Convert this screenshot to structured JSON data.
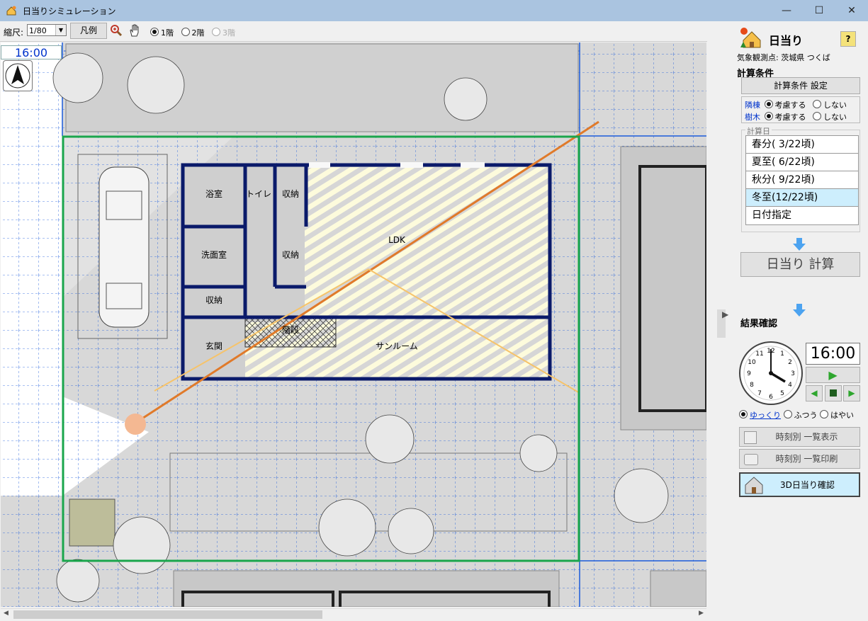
{
  "window": {
    "title": "日当りシミュレーション",
    "minimize_glyph": "—",
    "maximize_glyph": "☐",
    "close_glyph": "✕"
  },
  "toolbar": {
    "scale_label": "縮尺:",
    "scale_value": "1/80",
    "legend_button": "凡例",
    "floors": [
      {
        "label": "1階",
        "selected": true,
        "enabled": true
      },
      {
        "label": "2階",
        "selected": false,
        "enabled": true
      },
      {
        "label": "3階",
        "selected": false,
        "enabled": false
      }
    ]
  },
  "plan": {
    "time": "16:00",
    "rooms": {
      "bath": "浴室",
      "toilet": "トイレ",
      "storage1": "収納",
      "storage2": "収納",
      "storage3": "収納",
      "washroom": "洗面室",
      "ldk": "LDK",
      "stairs": "階段",
      "entrance": "玄関",
      "sunroom": "サンルーム"
    }
  },
  "panel": {
    "title": "日当り",
    "help_glyph": "?",
    "station": "気象観測点: 茨城県 つくば",
    "conditions_heading": "計算条件",
    "conditions_button": "計算条件 設定",
    "neighbor_label": "隣棟",
    "tree_label": "樹木",
    "consider": "考慮する",
    "not_consider": "しない",
    "calc_date_group": "計算日",
    "dates": [
      "春分( 3/22頃)",
      "夏至( 6/22頃)",
      "秋分( 9/22頃)",
      "冬至(12/22頃)",
      "日付指定"
    ],
    "selected_date_index": 3,
    "calc_button": "日当り 計算",
    "results_heading": "結果確認",
    "clock_time": "16:00",
    "speed_slow": "ゆっくり",
    "speed_normal": "ふつう",
    "speed_fast": "はやい",
    "hourly_list_button": "時刻別 一覧表示",
    "hourly_print_button": "時刻別 一覧印刷",
    "view3d_button": "3D日当り確認"
  },
  "colors": {
    "titlebar": "#aac4e0",
    "grid": "#1a5adb",
    "lot": "#1aa64c",
    "sunray": "#e07a2a",
    "sunlit": "#fdfbdc",
    "shadow": "#d2d2d2",
    "wall": "#0a1a6a",
    "selected_date": "#cdeefd",
    "time_text": "#0033cc"
  }
}
